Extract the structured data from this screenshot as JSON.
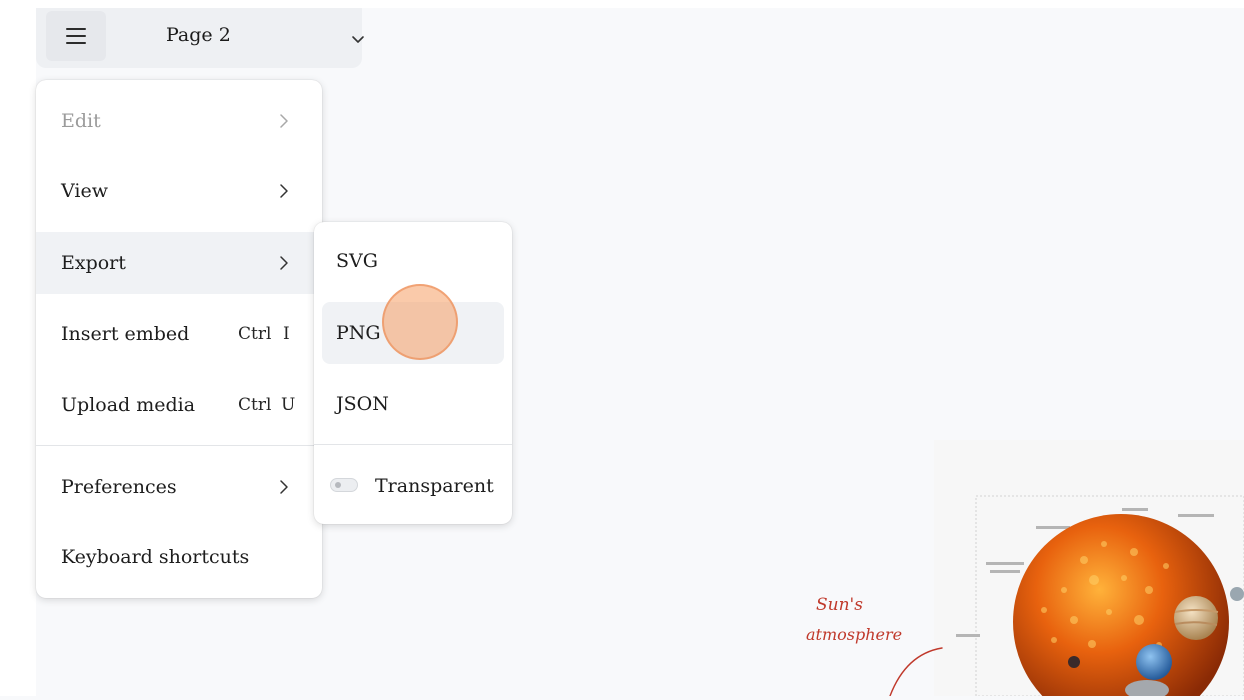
{
  "page_selector": {
    "page_name": "Page 2"
  },
  "main_menu": {
    "items": [
      {
        "label": "Edit",
        "disabled": true
      },
      {
        "label": "View"
      },
      {
        "label": "Export",
        "hover": true
      },
      {
        "label": "Insert embed",
        "shortcut": {
          "mod": "Ctrl",
          "key": "I"
        }
      },
      {
        "label": "Upload media",
        "shortcut": {
          "mod": "Ctrl",
          "key": "U"
        }
      },
      {
        "label": "Preferences"
      },
      {
        "label": "Keyboard shortcuts"
      }
    ]
  },
  "export_menu": {
    "items": [
      {
        "label": "SVG"
      },
      {
        "label": "PNG",
        "hover": true
      },
      {
        "label": "JSON"
      }
    ],
    "transparent_toggle": {
      "label": "Transparent",
      "on": false
    }
  },
  "canvas": {
    "handwritten_note": "Sun's atmosphere"
  },
  "colors": {
    "accent_click": "#f69e64",
    "handwriting": "#c0392b",
    "menu_hover": "#f0f2f5"
  },
  "icons": [
    "hamburger-icon",
    "chevron-down-icon",
    "chevron-right-icon",
    "toggle-icon"
  ]
}
